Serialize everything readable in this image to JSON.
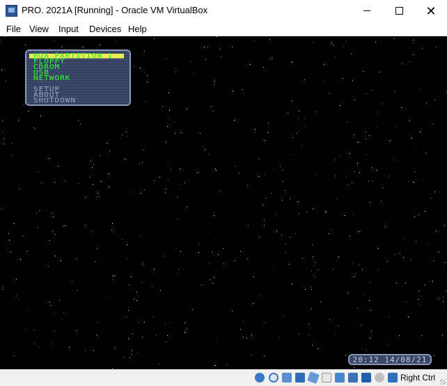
{
  "window": {
    "title": "PRO. 2021A [Running] - Oracle VM VirtualBox",
    "app_icon": "virtualbox-icon",
    "controls": [
      "minimize",
      "maximize",
      "close"
    ]
  },
  "menubar": {
    "items": [
      "File",
      "View",
      "Input",
      "Devices",
      "Help"
    ]
  },
  "boot_menu": {
    "items": [
      {
        "label": "HDA PARTITION 1",
        "selected": true,
        "color": "#32ff32"
      },
      {
        "label": "FLOPPY",
        "selected": false,
        "color": "#32ff32"
      },
      {
        "label": "CDROM",
        "selected": false,
        "color": "#32ff32"
      },
      {
        "label": "USB",
        "selected": false,
        "color": "#32ff32"
      },
      {
        "label": "NETWORK",
        "selected": false,
        "color": "#32ff32"
      }
    ],
    "system_items": [
      {
        "label": "SETUP",
        "color": "#a0a8b8"
      },
      {
        "label": "ABOUT",
        "color": "#a0a8b8"
      },
      {
        "label": "SHUTDOWN",
        "color": "#a0a8b8"
      }
    ],
    "highlight_color": "#e8ee56"
  },
  "clock": {
    "text": "20:12  14/08/21"
  },
  "statusbar": {
    "icons": [
      "hard-disk-icon",
      "optical-drive-icon",
      "audio-icon",
      "network-icon",
      "usb-icon",
      "shared-folders-icon",
      "display-icon",
      "video-capture-icon",
      "virtualization-icon",
      "mouse-integration-icon",
      "keyboard-icon"
    ],
    "host_key": "Right Ctrl"
  },
  "colors": {
    "screen_bg": "#000000",
    "panel_bg": "#3d4a6d",
    "panel_border": "#8a96b8"
  }
}
